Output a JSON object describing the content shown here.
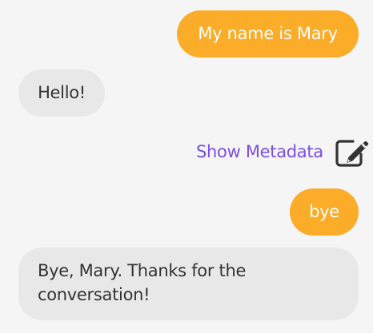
{
  "colors": {
    "background": "#f5f5f5",
    "user_bubble": "#fbac29",
    "bot_bubble": "#e8e8e8",
    "link": "#7a4ee8",
    "icon": "#333333"
  },
  "messages": [
    {
      "sender": "user",
      "text": "My name is Mary"
    },
    {
      "sender": "bot",
      "text": "Hello!"
    },
    {
      "sender": "user",
      "text": "bye"
    },
    {
      "sender": "bot",
      "text": "Bye, Mary. Thanks for the conversation!"
    }
  ],
  "metadata": {
    "link_label": "Show Metadata",
    "icon": "edit-icon"
  }
}
